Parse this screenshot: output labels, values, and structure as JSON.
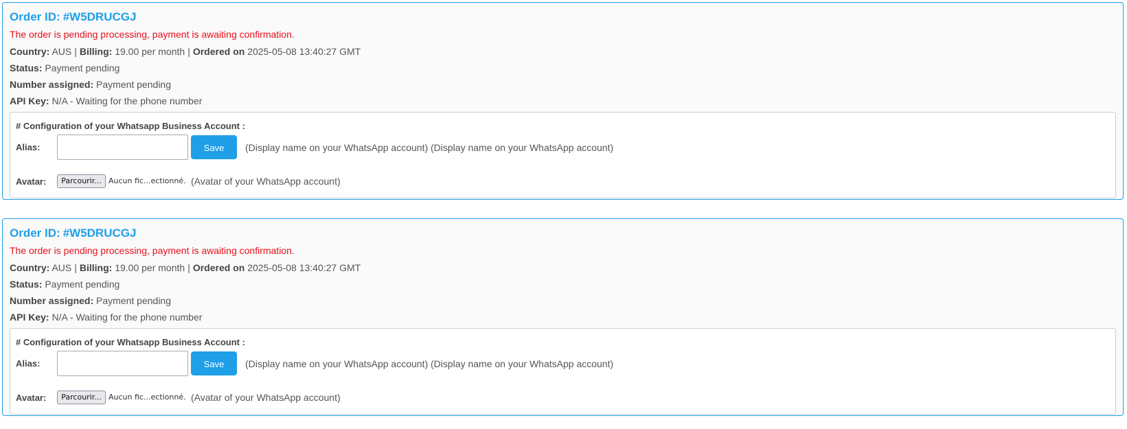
{
  "labels": {
    "order_id_label": "Order ID:",
    "country_label": "Country:",
    "billing_label": "Billing:",
    "ordered_on_label": "Ordered on",
    "separator": "|",
    "status_label": "Status:",
    "number_assigned_label": "Number assigned:",
    "api_key_label": "API Key:",
    "config_title": "# Configuration of your Whatsapp Business Account :",
    "alias_label": "Alias:",
    "avatar_label": "Avatar:",
    "save_button": "Save",
    "browse_button": "Parcourir...",
    "alias_hint": "(Display name on your WhatsApp account) (Display name on your WhatsApp account)",
    "avatar_hint": "(Avatar of your WhatsApp account)"
  },
  "orders": [
    {
      "order_id": "#W5DRUCGJ",
      "pending_message": "The order is pending processing, payment is awaiting confirmation.",
      "country": "AUS",
      "billing": "19.00 per month",
      "ordered_on": "2025-05-08 13:40:27 GMT",
      "status": "Payment pending",
      "number_assigned": "Payment pending",
      "api_key": "N/A - Waiting for the phone number",
      "alias_value": "",
      "file_status": "Aucun fic...ectionné."
    },
    {
      "order_id": "#W5DRUCGJ",
      "pending_message": "The order is pending processing, payment is awaiting confirmation.",
      "country": "AUS",
      "billing": "19.00 per month",
      "ordered_on": "2025-05-08 13:40:27 GMT",
      "status": "Payment pending",
      "number_assigned": "Payment pending",
      "api_key": "N/A - Waiting for the phone number",
      "alias_value": "",
      "file_status": "Aucun fic...ectionné."
    }
  ],
  "colors": {
    "accent": "#1e9fe8",
    "warning_text": "#e8101a",
    "card_background": "#fafafa",
    "body_text": "#555555"
  }
}
